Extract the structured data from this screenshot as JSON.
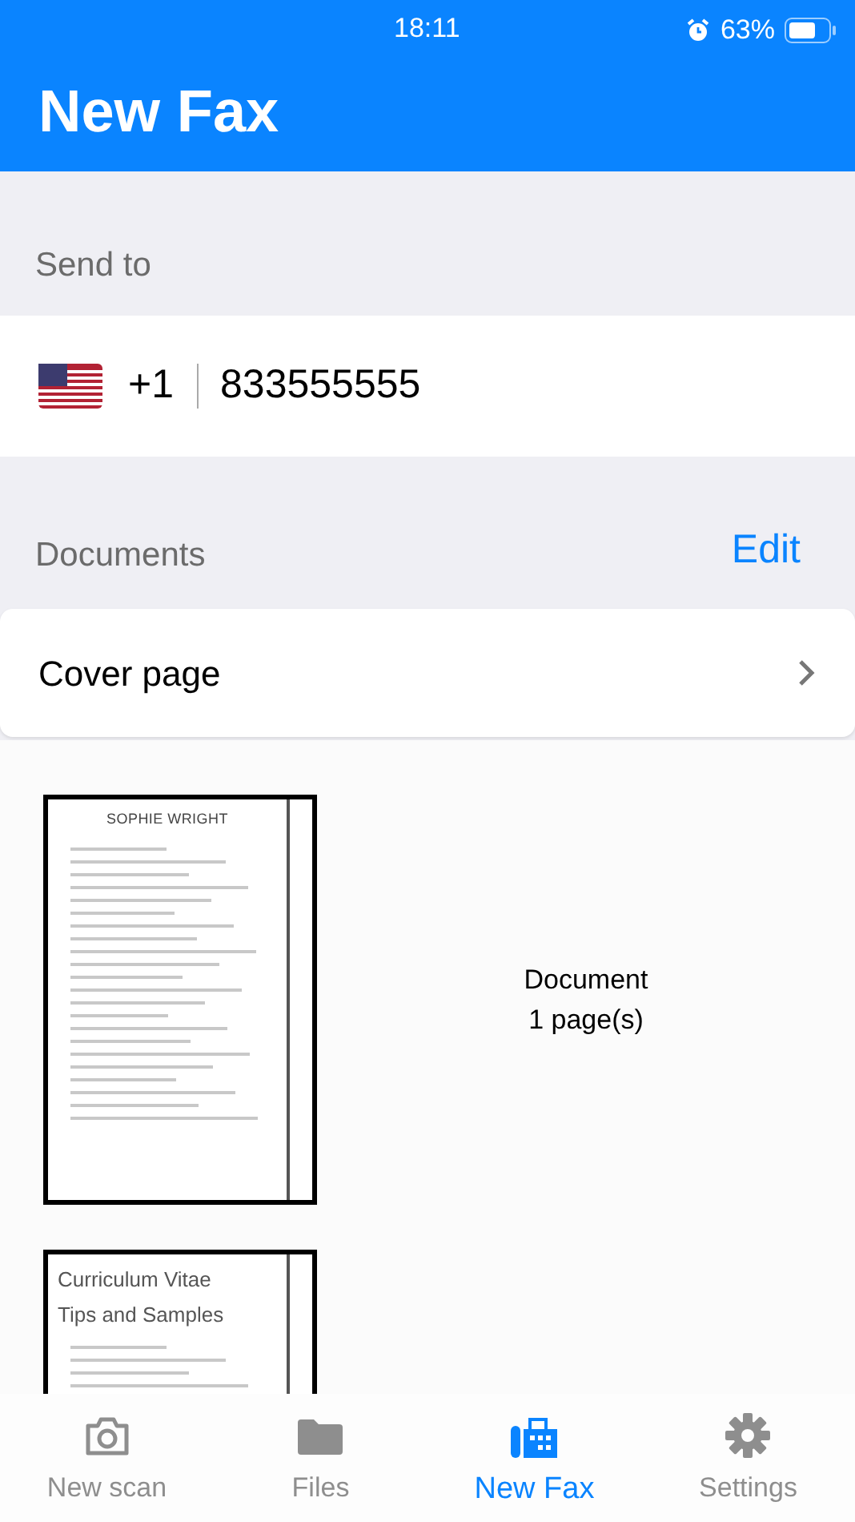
{
  "status_bar": {
    "time": "18:11",
    "battery": "63%"
  },
  "header": {
    "title": "New Fax"
  },
  "send_to": {
    "label": "Send to",
    "country_code": "+1",
    "number": "833555555"
  },
  "documents": {
    "label": "Documents",
    "edit": "Edit",
    "cover_page": "Cover page",
    "items": [
      {
        "heading": [
          "SOPHIE WRIGHT"
        ],
        "title": "Document",
        "pages": "1 page(s)"
      },
      {
        "heading": [
          "Curriculum Vitae",
          "Tips and Samples"
        ]
      }
    ]
  },
  "tabs": [
    {
      "label": "New scan",
      "kind": "camera",
      "selected": false
    },
    {
      "label": "Files",
      "kind": "folder",
      "selected": false
    },
    {
      "label": "New Fax",
      "kind": "fax",
      "selected": true
    },
    {
      "label": "Settings",
      "kind": "gear",
      "selected": false
    }
  ]
}
